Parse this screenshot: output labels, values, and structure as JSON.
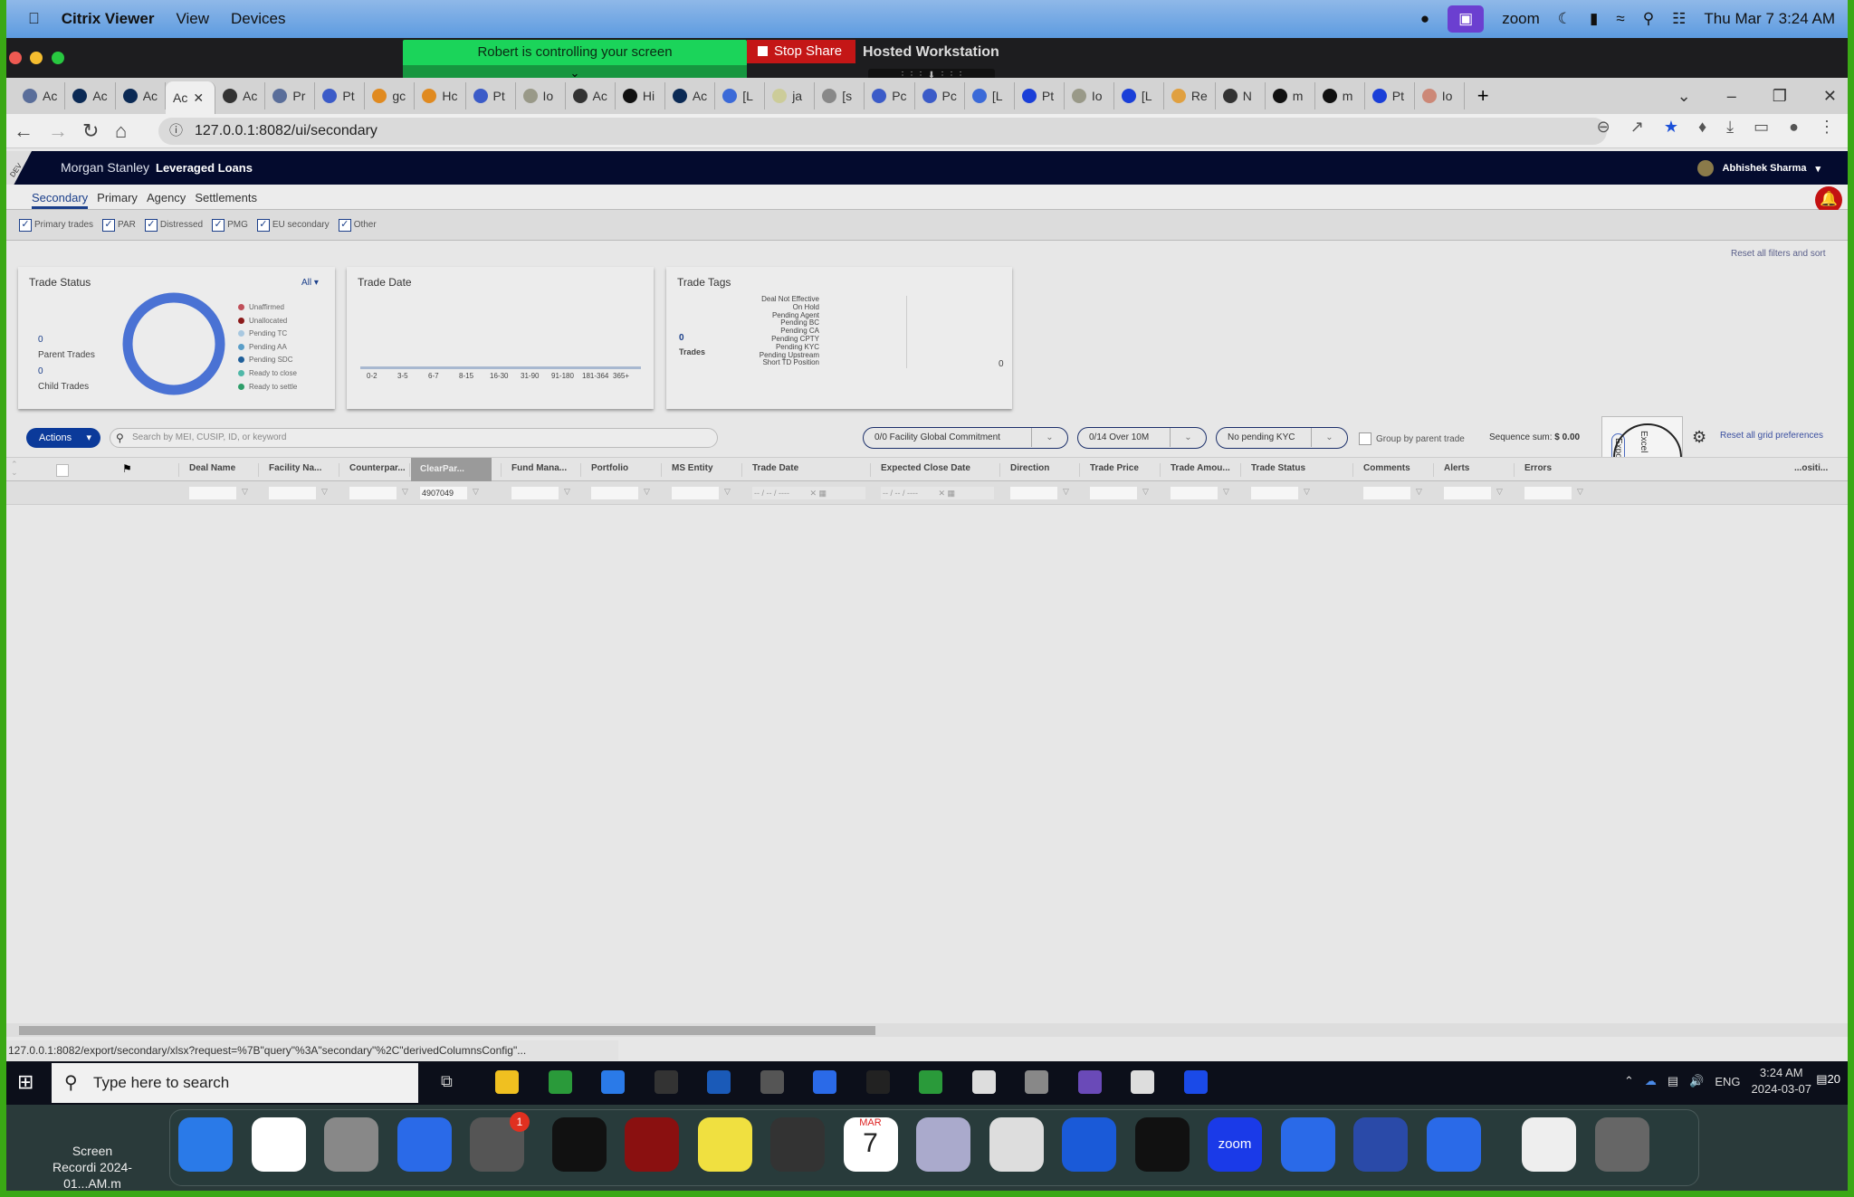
{
  "mac_menu": {
    "app": "Citrix Viewer",
    "items": [
      "View",
      "Devices"
    ],
    "zoom_label": "zoom",
    "datetime": "Thu Mar 7  3:24 AM"
  },
  "zoom_share": {
    "banner": "Robert is controlling your screen",
    "stop_share": "Stop Share",
    "window_title": "Hosted Workstation"
  },
  "browser": {
    "tabs": [
      "Ac",
      "Ac",
      "Ac",
      "Ac",
      "Ac",
      "Pr",
      "Pt",
      "gc",
      "Hc",
      "Pt",
      "Io",
      "Ac",
      "Hi",
      "Ac",
      "[L",
      "ja",
      "[s",
      "Pc",
      "Pc",
      "[L",
      "Pt",
      "Io",
      "[L",
      "Re",
      "N",
      "m",
      "m",
      "Pt",
      "Io"
    ],
    "active_tab": 3,
    "url": "127.0.0.1:8082/ui/secondary",
    "status_url": "127.0.0.1:8082/export/secondary/xlsx?request=%7B\"query\"%3A\"secondary\"%2C\"derivedColumnsConfig\"..."
  },
  "app": {
    "env_badge": "DEV",
    "brand": "Morgan Stanley",
    "product": "Leveraged Loans",
    "user": "Abhishek Sharma",
    "nav_tabs": [
      "Secondary",
      "Primary",
      "Agency",
      "Settlements"
    ],
    "active_nav": 0,
    "filters": [
      {
        "label": "Primary trades",
        "checked": true
      },
      {
        "label": "PAR",
        "checked": true
      },
      {
        "label": "Distressed",
        "checked": true
      },
      {
        "label": "PMG",
        "checked": true
      },
      {
        "label": "EU secondary",
        "checked": true
      },
      {
        "label": "Other",
        "checked": true
      }
    ],
    "reset_filters": "Reset all filters and sort",
    "trade_status": {
      "title": "Trade Status",
      "dropdown": "All",
      "parent_count": "0",
      "parent_label": "Parent Trades",
      "child_count": "0",
      "child_label": "Child Trades",
      "legend": [
        {
          "label": "Unaffirmed",
          "color": "#c0505a"
        },
        {
          "label": "Unallocated",
          "color": "#8b1a1a"
        },
        {
          "label": "Pending TC",
          "color": "#a8c8e0"
        },
        {
          "label": "Pending AA",
          "color": "#5a9ec8"
        },
        {
          "label": "Pending SDC",
          "color": "#1f5f9a"
        },
        {
          "label": "Ready to close",
          "color": "#4fb8a8"
        },
        {
          "label": "Ready to settle",
          "color": "#2e9e6a"
        }
      ],
      "donut_color": "#4a72d4"
    },
    "trade_date": {
      "title": "Trade Date",
      "buckets": [
        "0-2",
        "3-5",
        "6-7",
        "8-15",
        "16-30",
        "31-90",
        "91-180",
        "181-364",
        "365+"
      ]
    },
    "trade_tags": {
      "title": "Trade Tags",
      "count": "0",
      "count_label": "Trades",
      "tags": [
        "Deal Not Effective",
        "On Hold",
        "Pending Agent",
        "Pending BC",
        "Pending CA",
        "Pending CPTY",
        "Pending KYC",
        "Pending Upstream",
        "Short TD Position"
      ],
      "axis_value": "0"
    },
    "toolbar": {
      "actions": "Actions",
      "search_placeholder": "Search by MEI, CUSIP, ID, or keyword",
      "pills": [
        "0/0  Facility Global Commitment",
        "0/14  Over 10M",
        "No pending KYC"
      ],
      "group_by": "Group by parent trade",
      "sequence_sum_label": "Sequence sum:",
      "sequence_sum_value": "$ 0.00",
      "export_label": "Export",
      "excel_label": "Excel",
      "reset_grid": "Reset all grid preferences"
    },
    "grid": {
      "columns": [
        "Deal Name",
        "Facility Na...",
        "Counterpar...",
        "ClearPar...",
        "Fund Mana...",
        "Portfolio",
        "MS Entity",
        "Trade Date",
        "Expected Close Date",
        "Direction",
        "Trade Price",
        "Trade Amou...",
        "Trade Status",
        "Comments",
        "Alerts",
        "Errors",
        "...ositi..."
      ],
      "highlighted_column": "ClearPar...",
      "clearpar_filter": "4907049",
      "date_placeholder": "-- / -- / ----"
    }
  },
  "taskbar": {
    "search_placeholder": "Type here to search",
    "lang": "ENG",
    "time": "3:24 AM",
    "date": "2024-03-07",
    "notifications": "20"
  },
  "dock": {
    "recording_label": "Screen Recordi 2024-01...AM.m",
    "calendar_month": "MAR",
    "calendar_day": "7",
    "settings_badge": "1",
    "zoom_label": "zoom"
  }
}
